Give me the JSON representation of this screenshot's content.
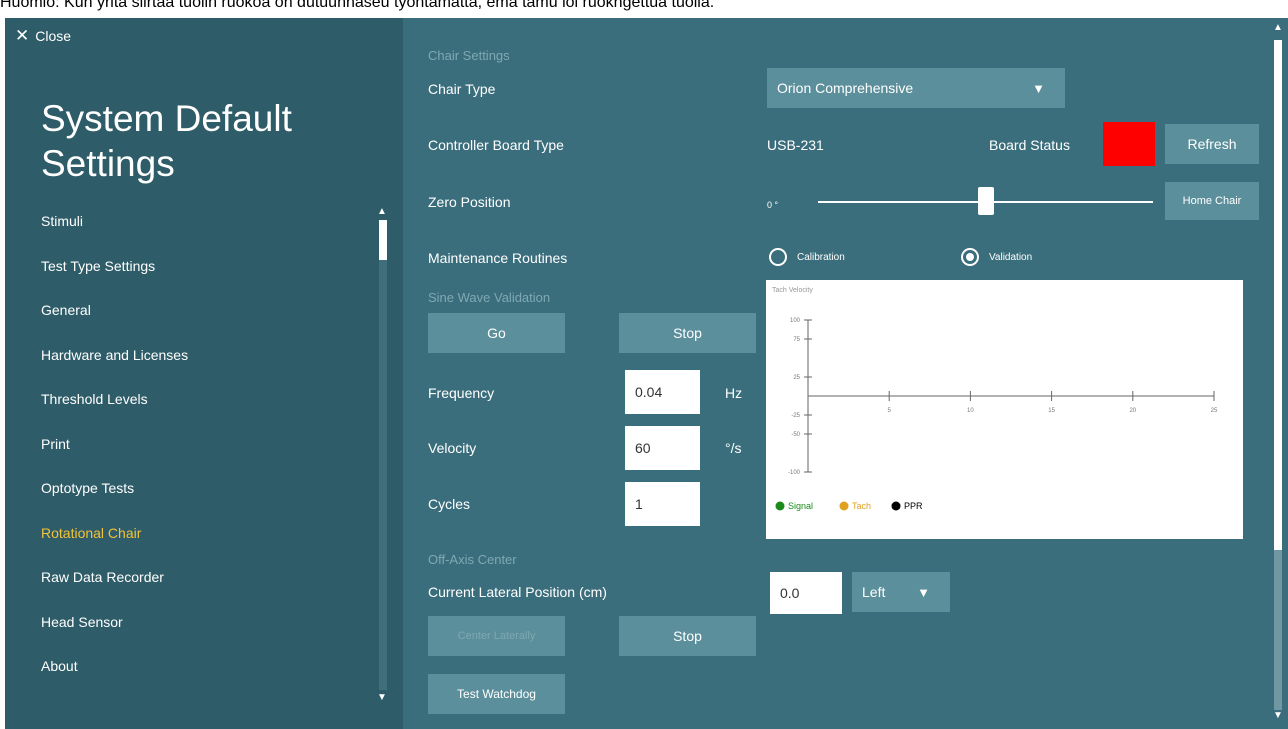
{
  "banner": "Huomio: Kun yritä siirtää tuolin ruokoa on dutuunnaseu tyohtamatta, ema tamu ioi ruokngettua tuolla.",
  "sidebar": {
    "close_label": "Close",
    "title": "System Default Settings",
    "items": [
      {
        "label": "Stimuli",
        "active": false
      },
      {
        "label": "Test Type Settings",
        "active": false
      },
      {
        "label": "General",
        "active": false
      },
      {
        "label": "Hardware and Licenses",
        "active": false
      },
      {
        "label": "Threshold Levels",
        "active": false
      },
      {
        "label": "Print",
        "active": false
      },
      {
        "label": "Optotype Tests",
        "active": false
      },
      {
        "label": "Rotational Chair",
        "active": true
      },
      {
        "label": "Raw Data Recorder",
        "active": false
      },
      {
        "label": "Head Sensor",
        "active": false
      },
      {
        "label": "About",
        "active": false
      }
    ]
  },
  "main": {
    "chair_settings_header": "Chair Settings",
    "chair_type_label": "Chair Type",
    "chair_type_value": "Orion Comprehensive",
    "controller_label": "Controller Board Type",
    "controller_value": "USB-231",
    "board_status_label": "Board Status",
    "board_status_color": "#ff0000",
    "refresh_label": "Refresh",
    "zero_position_label": "Zero Position",
    "zero_position_value": "0 °",
    "zero_position_fraction": 0.5,
    "home_chair_label": "Home Chair",
    "maintenance_label": "Maintenance Routines",
    "radio_calibration": "Calibration",
    "radio_validation": "Validation",
    "selected_routine": "Validation",
    "sine_header": "Sine Wave Validation",
    "go_label": "Go",
    "stop_label": "Stop",
    "frequency_label": "Frequency",
    "frequency_value": "0.04",
    "frequency_unit": "Hz",
    "velocity_label": "Velocity",
    "velocity_value": "60",
    "velocity_unit": "°/s",
    "cycles_label": "Cycles",
    "cycles_value": "1",
    "off_axis_header": "Off-Axis Center",
    "lateral_label": "Current Lateral Position (cm)",
    "lateral_value": "0.0",
    "lateral_side": "Left",
    "center_laterally_label": "Center Laterally",
    "stop2_label": "Stop",
    "watchdog_label": "Test Watchdog"
  },
  "chart_data": {
    "type": "line",
    "title": "Tach Velocity",
    "xlim": [
      0,
      25
    ],
    "ylim": [
      -100,
      100
    ],
    "x_ticks": [
      5,
      10,
      15,
      20,
      25
    ],
    "y_ticks": [
      100,
      75,
      25,
      -25,
      -50,
      -100
    ],
    "series": [
      {
        "name": "Signal",
        "color": "#1a8a1a",
        "values": []
      },
      {
        "name": "Tach",
        "color": "#e0a020",
        "values": []
      },
      {
        "name": "PPR",
        "color": "#000000",
        "values": []
      }
    ]
  }
}
